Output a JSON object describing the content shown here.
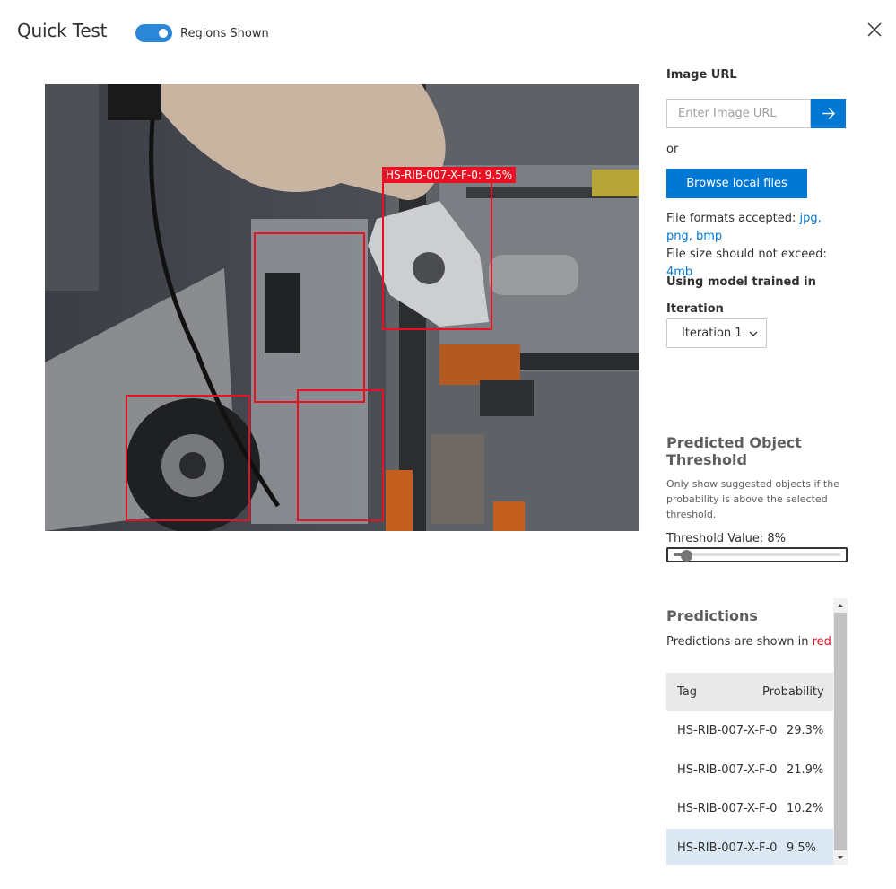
{
  "header": {
    "title": "Quick Test",
    "toggle_label": "Regions Shown",
    "toggle_on": true
  },
  "image": {
    "regions": [
      {
        "label": "HS-RIB-007-X-F-0: 9.5%"
      }
    ]
  },
  "sidebar": {
    "image_url_label": "Image URL",
    "image_url_placeholder": "Enter Image URL",
    "image_url_value": "",
    "or_text": "or",
    "browse_label": "Browse local files",
    "formats_prefix": "File formats accepted: ",
    "formats_value": "jpg, png, bmp",
    "size_prefix": "File size should not exceed: ",
    "size_value": "4mb",
    "model_label": "Using model trained in",
    "iteration_label": "Iteration",
    "iteration_selected": "Iteration 1"
  },
  "threshold": {
    "title": "Predicted Object Threshold",
    "description": "Only show suggested objects if the probability is above the selected threshold.",
    "value_text": "Threshold Value: 8%",
    "value": 8
  },
  "predictions": {
    "title": "Predictions",
    "subtitle_prefix": "Predictions are shown in ",
    "subtitle_color_word": "red",
    "columns": {
      "tag": "Tag",
      "probability": "Probability"
    },
    "rows": [
      {
        "tag": "HS-RIB-007-X-F-0",
        "probability": "29.3%"
      },
      {
        "tag": "HS-RIB-007-X-F-0",
        "probability": "21.9%"
      },
      {
        "tag": "HS-RIB-007-X-F-0",
        "probability": "10.2%"
      },
      {
        "tag": "HS-RIB-007-X-F-0",
        "probability": "9.5%"
      }
    ]
  },
  "colors": {
    "accent": "#0078d4",
    "toggle": "#2b88d8",
    "region": "#e81123",
    "selected_row": "#dce9f5"
  },
  "icons": {
    "close": "close-icon",
    "go": "arrow-right-icon",
    "dropdown": "chevron-down-icon"
  }
}
